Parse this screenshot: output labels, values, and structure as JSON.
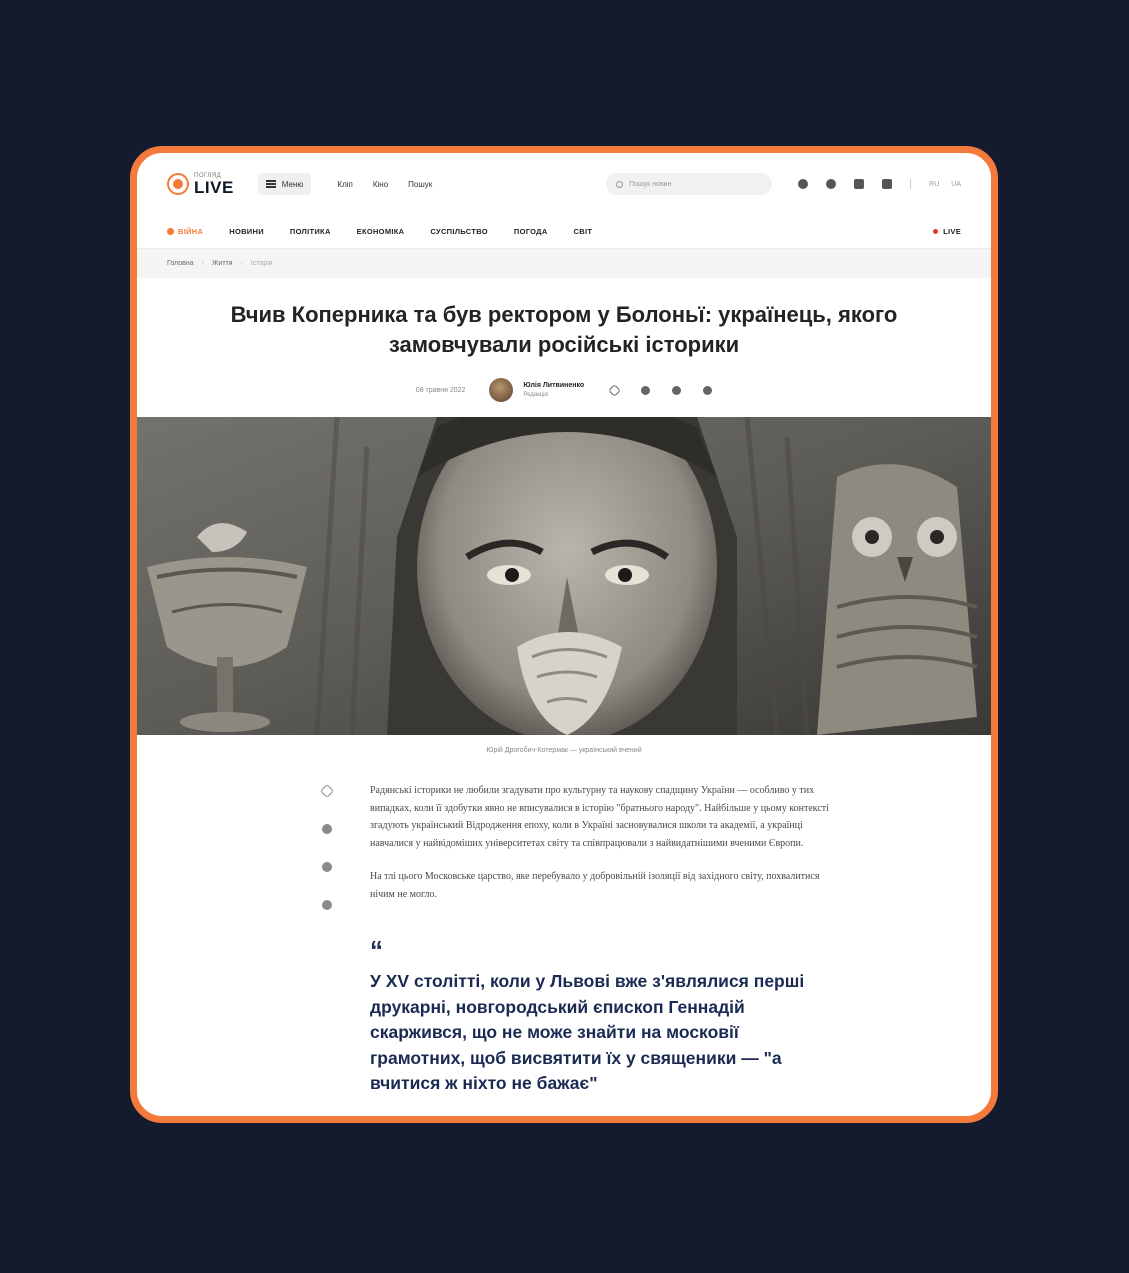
{
  "header": {
    "logo_top": "ПОГЛЯД",
    "logo_text": "LIVE",
    "menu_label": "Меню",
    "links": [
      "Кліп",
      "Кіно",
      "Пошук"
    ],
    "search_placeholder": "Пошук новин",
    "langs": [
      "RU",
      "UA"
    ]
  },
  "nav": {
    "items": [
      "ВІЙНА",
      "НОВИНИ",
      "ПОЛІТИКА",
      "ЕКОНОМІКА",
      "СУСПІЛЬСТВО",
      "ПОГОДА",
      "СВІТ"
    ],
    "live_label": "LIVE"
  },
  "breadcrumbs": [
    "Головна",
    "Життя",
    "Історія"
  ],
  "article": {
    "title": "Вчив Коперника та був ректором у Болоньї: українець, якого замовчували російські історики",
    "date": "08 травня 2022",
    "author_name": "Юлія Литвиненко",
    "author_role": "Редакція",
    "image_caption": "Юрій Дрогобич-Котермак — український вчений",
    "paragraphs": [
      "Радянські історики не любили згадувати про культурну та наукову спадщину України — особливо у тих випадках, коли її здобутки явно не вписувалися в історію \"братнього народу\". Найбільше у цьому контексті згадують український Відродження епоху, коли в Україні засновувалися школи та академії, а українці навчалися у найвідоміших університетах світу та співпрацювали з найвидатнішими вченими Європи.",
      "На тлі цього Московське царство, яке перебувало у добровільній ізоляції від західного світу, похвалитися нічим не могло."
    ],
    "quote": "У XV столітті, коли у Львові вже з'являлися перші друкарні, новгородський єпископ Геннадій скаржився, що не може знайти на московії грамотних, щоб висвятити їх у священики — \"а вчитися ж ніхто не бажає\""
  }
}
